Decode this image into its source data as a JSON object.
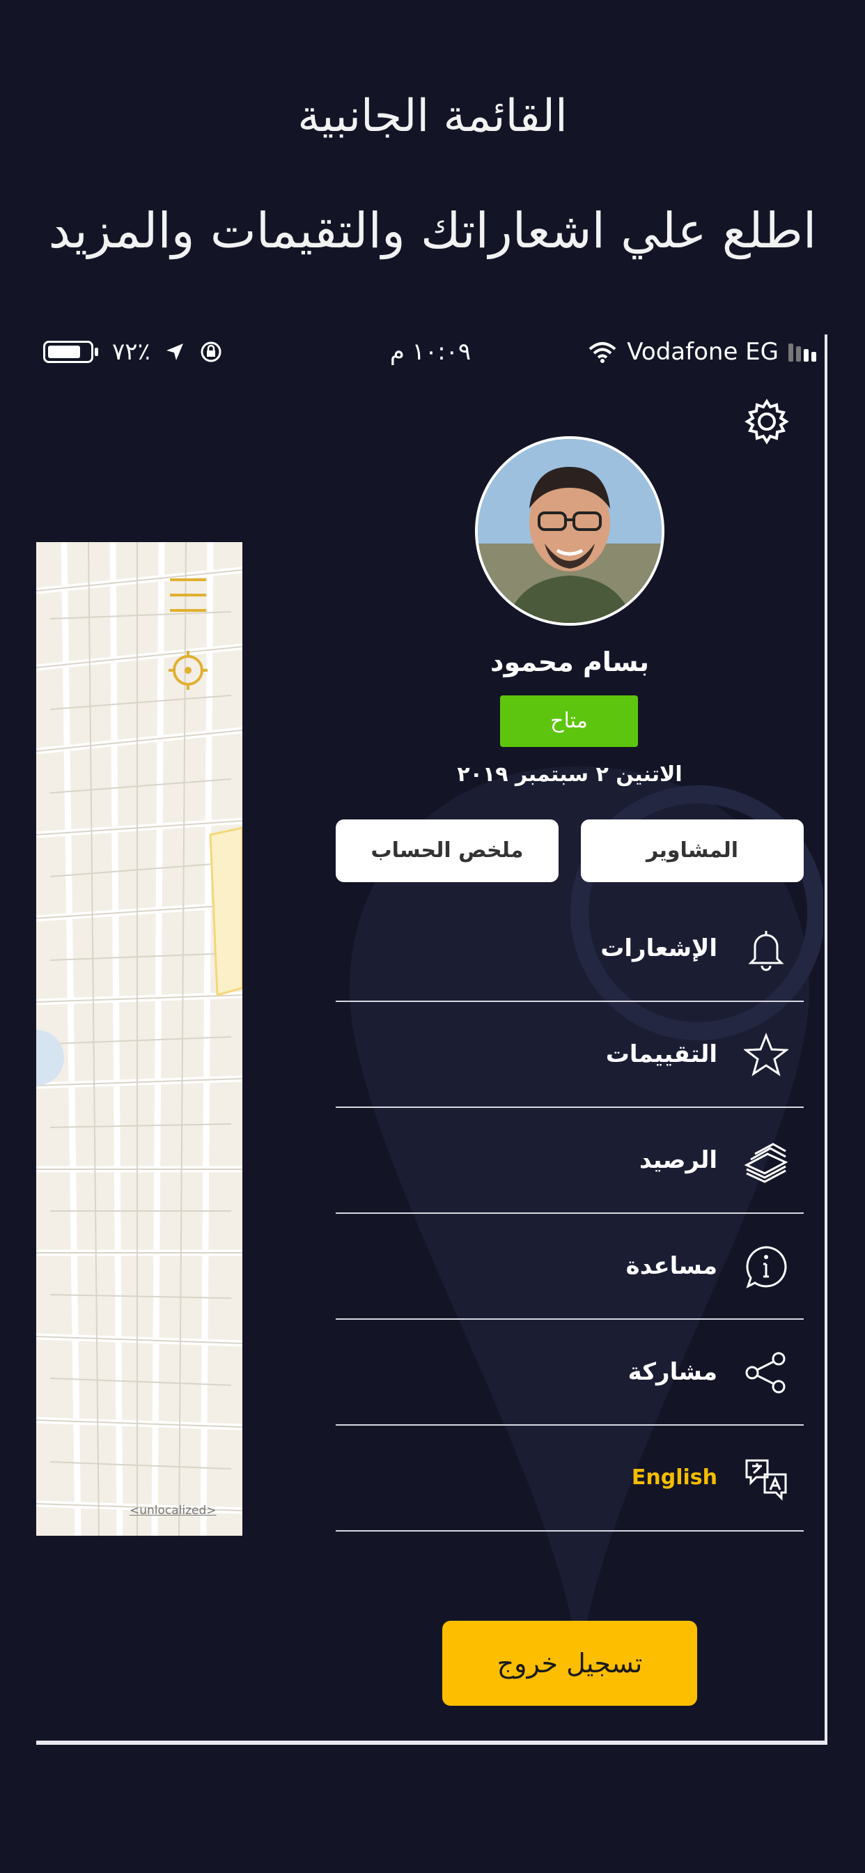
{
  "promo": {
    "title": "القائمة الجانبية",
    "subtitle": "اطلع علي اشعاراتك والتقيمات والمزيد"
  },
  "status_bar": {
    "battery": "٧٢٪",
    "time": "١٠:٠٩ م",
    "carrier": "Vodafone EG"
  },
  "map": {
    "attribution": "<unlocalized>"
  },
  "profile": {
    "name": "بسام محمود",
    "status": "متاح",
    "date": "الاتنين ٢ سبتمبر ٢٠١٩"
  },
  "actions": {
    "history": "المشاوير",
    "summary": "ملخص الحساب"
  },
  "menu": [
    {
      "label": "الإشعارات",
      "icon": "bell-icon"
    },
    {
      "label": "التقييمات",
      "icon": "star-icon"
    },
    {
      "label": "الرصيد",
      "icon": "money-stack-icon"
    },
    {
      "label": "مساعدة",
      "icon": "info-icon"
    },
    {
      "label": "مشاركة",
      "icon": "share-icon"
    },
    {
      "label": "English",
      "icon": "language-icon"
    }
  ],
  "logout": "تسجيل خروج",
  "colors": {
    "background": "#131527",
    "accent": "#fdbe00",
    "available": "#5ec50e"
  }
}
